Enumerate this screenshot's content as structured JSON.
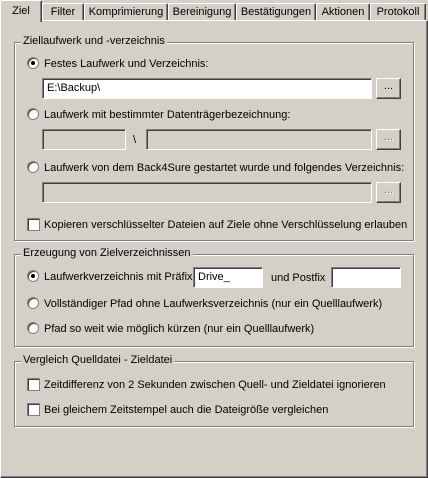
{
  "tabs": [
    {
      "label": "Ziel"
    },
    {
      "label": "Filter"
    },
    {
      "label": "Komprimierung"
    },
    {
      "label": "Bereinigung"
    },
    {
      "label": "Bestätigungen"
    },
    {
      "label": "Aktionen"
    },
    {
      "label": "Protokoll"
    }
  ],
  "target": {
    "title": "Ziellaufwerk und -verzeichnis",
    "fixed_label": "Festes Laufwerk und Verzeichnis:",
    "fixed_path": "E:\\Backup\\",
    "volume_label": "Laufwerk mit bestimmter Datenträgerbezeichnung:",
    "volume_separator": "\\",
    "started_label": "Laufwerk von dem Back4Sure gestartet wurde und folgendes Verzeichnis:",
    "browse_label": "...",
    "copy_encrypted_label": "Kopieren verschlüsselter Dateien auf Ziele ohne Verschlüsselung erlauben"
  },
  "dirs": {
    "title": "Erzeugung von Zielverzeichnissen",
    "prefix_label": "Laufwerkverzeichnis mit Präfix",
    "prefix_value": "Drive_",
    "postfix_label": "und Postfix",
    "postfix_value": "",
    "full_path_label": "Vollständiger Pfad ohne Laufwerksverzeichnis (nur ein Quelllaufwerk)",
    "shorten_label": "Pfad so weit wie möglich kürzen (nur ein Quelllaufwerk)"
  },
  "compare": {
    "title": "Vergleich Quelldatei - Zieldatei",
    "ignore_2s_label": "Zeitdifferenz von 2 Sekunden zwischen Quell- und Zieldatei ignorieren",
    "size_label": "Bei gleichem Zeitstempel auch die Dateigröße vergleichen"
  },
  "colors": {
    "face": "#d4d0c8",
    "shadow": "#808080",
    "highlight": "#ffffff"
  }
}
